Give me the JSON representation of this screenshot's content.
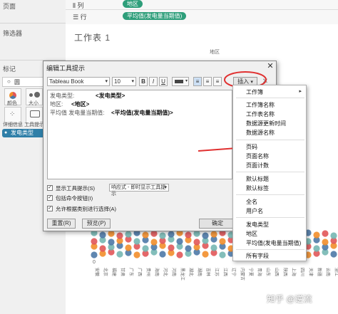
{
  "workspace": {
    "left_panel": {
      "pages_title": "页面",
      "filters_title": "筛选器",
      "marks_title": "标记",
      "marks_type": "圆",
      "mark_buttons": [
        {
          "label": "颜色",
          "icon": "color-icon"
        },
        {
          "label": "大小",
          "icon": "size-icon"
        },
        {
          "label": "工具提示",
          "icon": "tooltip-icon"
        },
        {
          "label": "详细信息",
          "icon": "detail-icon"
        }
      ],
      "color_pill": "发电类型"
    },
    "shelves": {
      "columns_label": "列",
      "columns_pill": "地区",
      "rows_label": "行",
      "rows_pill": "平均值(发电量当期值)"
    },
    "sheet": {
      "title": "工作表 1",
      "region_header": "地区",
      "axis_tick": "0",
      "regions": [
        "安徽",
        "北京",
        "福建",
        "甘肃",
        "广东",
        "广西",
        "贵州",
        "海南",
        "河北",
        "河南",
        "黑龙江",
        "湖北",
        "湖南",
        "吉林",
        "江苏",
        "江西",
        "辽宁",
        "内蒙古",
        "宁夏",
        "青海",
        "山东",
        "山西",
        "陕西",
        "上海",
        "四川",
        "天津",
        "新疆",
        "云南",
        "浙江"
      ]
    }
  },
  "dialog": {
    "title": "编辑工具提示",
    "font_family": "Tableau Book",
    "font_size": "10",
    "bold": "B",
    "italic": "I",
    "underline": "U",
    "insert_label": "插入",
    "clear_icon": "close-icon",
    "editor_lines": [
      {
        "label": "发电类型:",
        "field": "<发电类型>"
      },
      {
        "label": "地区:",
        "field": "<地区>"
      },
      {
        "label": "平均值 发电量当期值:",
        "field": "<平均值(发电量当期值)>"
      }
    ],
    "options": [
      {
        "label": "显示工具提示(S)",
        "checked": true
      },
      {
        "label": "包括命令按钮(I)",
        "checked": true
      },
      {
        "label": "允许根据类别进行选择(A)",
        "checked": true
      }
    ],
    "tooltip_mode": "响应式 - 即时显示工具提示",
    "buttons": {
      "reset": "重置(R)",
      "preview": "预览(P)",
      "ok": "确定"
    }
  },
  "insert_menu": {
    "items": [
      {
        "label": "工作簿",
        "submenu": true
      },
      {
        "label": "工作簿名称"
      },
      {
        "label": "工作表名称"
      },
      {
        "label": "数据源更新时间"
      },
      {
        "label": "数据源名称"
      },
      {
        "label": "页码"
      },
      {
        "label": "页面名称"
      },
      {
        "label": "页面计数"
      },
      {
        "label": "默认标题"
      },
      {
        "label": "默认标签"
      },
      {
        "label": "全名"
      },
      {
        "label": "用户名"
      },
      {
        "label": "发电类型"
      },
      {
        "label": "地区"
      },
      {
        "label": "平均值(发电量当期值)"
      },
      {
        "label": "所有字段"
      }
    ]
  },
  "watermark": "知乎 @逆流",
  "colors": {
    "pill_green": "#2e9e7a",
    "pill_blue": "#2f7fa8",
    "annotation_red": "#e03030",
    "dot_blue": "#4e79a7",
    "dot_orange": "#f28e2b",
    "dot_red": "#e15759",
    "dot_teal": "#76b7b2"
  }
}
